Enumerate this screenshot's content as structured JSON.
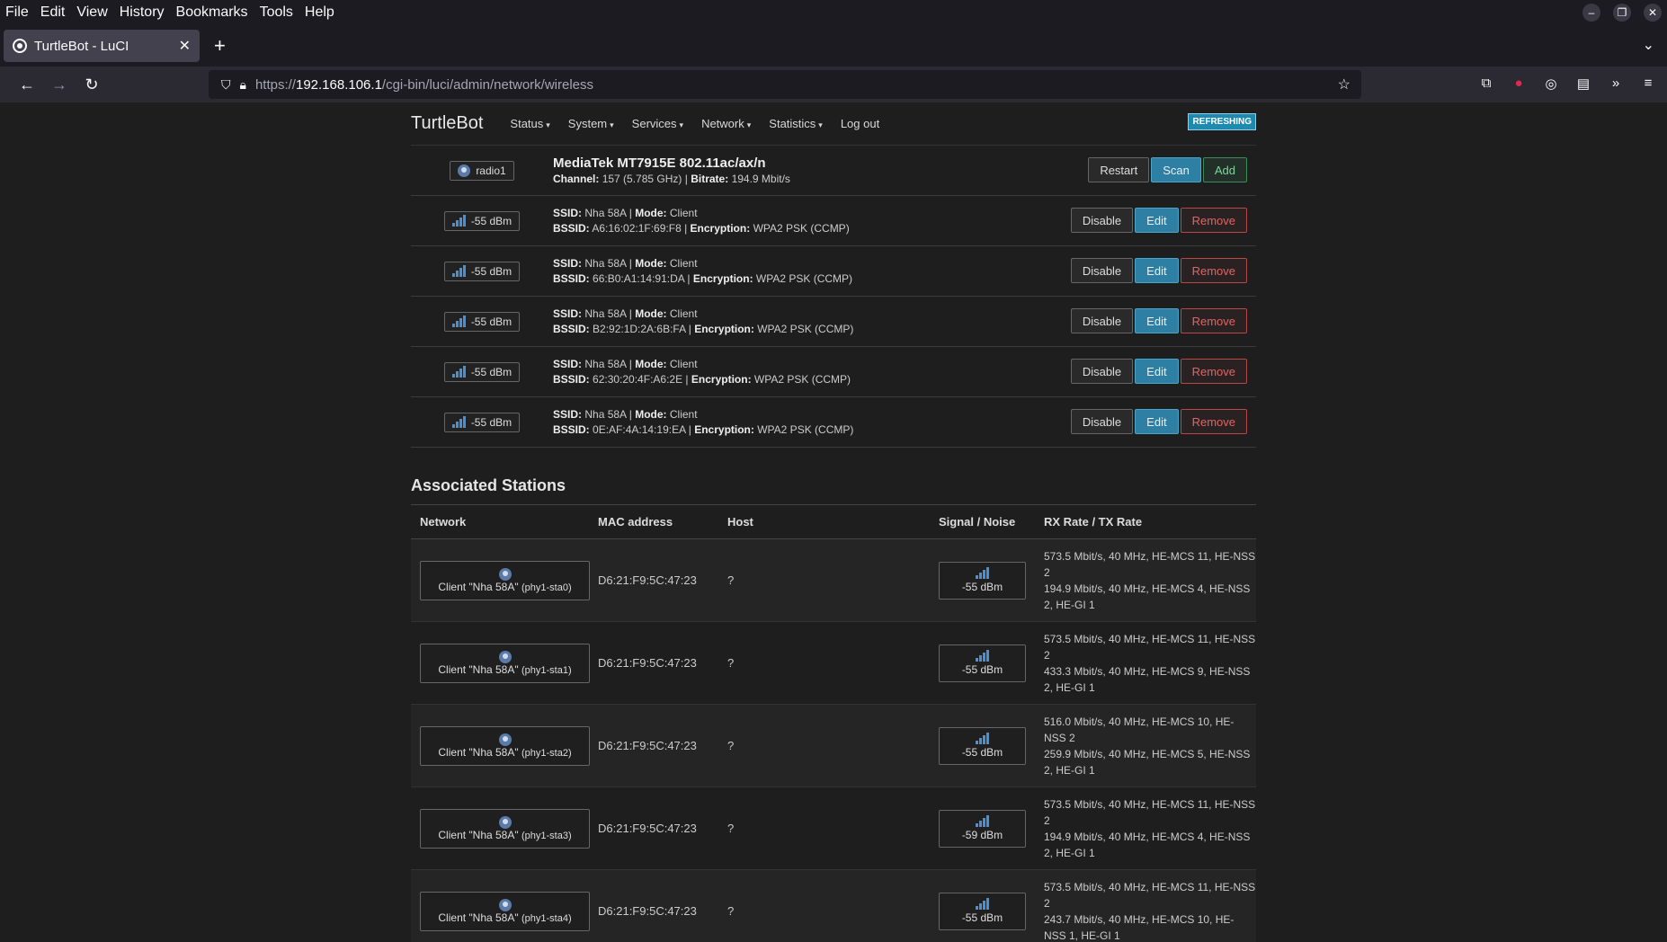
{
  "browser": {
    "menu": [
      "File",
      "Edit",
      "View",
      "History",
      "Bookmarks",
      "Tools",
      "Help"
    ],
    "tab_title": "TurtleBot - LuCI",
    "url_prefix": "https://",
    "url_host": "192.168.106.1",
    "url_path": "/cgi-bin/luci/admin/network/wireless"
  },
  "header": {
    "brand": "TurtleBot",
    "nav": [
      "Status",
      "System",
      "Services",
      "Network",
      "Statistics"
    ],
    "logout": "Log out",
    "refreshing": "REFRESHING"
  },
  "radio": {
    "name": "radio1",
    "model": "MediaTek MT7915E 802.11ac/ax/n",
    "channel_label": "Channel:",
    "channel": "157 (5.785 GHz)",
    "bitrate_label": "Bitrate:",
    "bitrate": "194.9 Mbit/s",
    "buttons": [
      "Restart",
      "Scan",
      "Add"
    ]
  },
  "wifi_rows": [
    {
      "signal": "-55 dBm",
      "ssid": "Nha 58A",
      "mode": "Client",
      "bssid": "A6:16:02:1F:69:F8",
      "encryption": "WPA2 PSK (CCMP)"
    },
    {
      "signal": "-55 dBm",
      "ssid": "Nha 58A",
      "mode": "Client",
      "bssid": "66:B0:A1:14:91:DA",
      "encryption": "WPA2 PSK (CCMP)"
    },
    {
      "signal": "-55 dBm",
      "ssid": "Nha 58A",
      "mode": "Client",
      "bssid": "B2:92:1D:2A:6B:FA",
      "encryption": "WPA2 PSK (CCMP)"
    },
    {
      "signal": "-55 dBm",
      "ssid": "Nha 58A",
      "mode": "Client",
      "bssid": "62:30:20:4F:A6:2E",
      "encryption": "WPA2 PSK (CCMP)"
    },
    {
      "signal": "-55 dBm",
      "ssid": "Nha 58A",
      "mode": "Client",
      "bssid": "0E:AF:4A:14:19:EA",
      "encryption": "WPA2 PSK (CCMP)"
    }
  ],
  "labels": {
    "ssid": "SSID:",
    "mode": "Mode:",
    "bssid": "BSSID:",
    "encryption": "Encryption:",
    "disable": "Disable",
    "edit": "Edit",
    "remove": "Remove"
  },
  "stations": {
    "title": "Associated Stations",
    "columns": [
      "Network",
      "MAC address",
      "Host",
      "Signal / Noise",
      "RX Rate / TX Rate"
    ],
    "rows": [
      {
        "network": "Client \"Nha 58A\"",
        "iface": "(phy1-sta0)",
        "mac": "D6:21:F9:5C:47:23",
        "host": "?",
        "signal": "-55 dBm",
        "rx": "573.5 Mbit/s, 40 MHz, HE-MCS 11, HE-NSS 2",
        "tx": "194.9 Mbit/s, 40 MHz, HE-MCS 4, HE-NSS 2, HE-GI 1"
      },
      {
        "network": "Client \"Nha 58A\"",
        "iface": "(phy1-sta1)",
        "mac": "D6:21:F9:5C:47:23",
        "host": "?",
        "signal": "-55 dBm",
        "rx": "573.5 Mbit/s, 40 MHz, HE-MCS 11, HE-NSS 2",
        "tx": "433.3 Mbit/s, 40 MHz, HE-MCS 9, HE-NSS 2, HE-GI 1"
      },
      {
        "network": "Client \"Nha 58A\"",
        "iface": "(phy1-sta2)",
        "mac": "D6:21:F9:5C:47:23",
        "host": "?",
        "signal": "-55 dBm",
        "rx": "516.0 Mbit/s, 40 MHz, HE-MCS 10, HE-NSS 2",
        "tx": "259.9 Mbit/s, 40 MHz, HE-MCS 5, HE-NSS 2, HE-GI 1"
      },
      {
        "network": "Client \"Nha 58A\"",
        "iface": "(phy1-sta3)",
        "mac": "D6:21:F9:5C:47:23",
        "host": "?",
        "signal": "-59 dBm",
        "rx": "573.5 Mbit/s, 40 MHz, HE-MCS 11, HE-NSS 2",
        "tx": "194.9 Mbit/s, 40 MHz, HE-MCS 4, HE-NSS 2, HE-GI 1"
      },
      {
        "network": "Client \"Nha 58A\"",
        "iface": "(phy1-sta4)",
        "mac": "D6:21:F9:5C:47:23",
        "host": "?",
        "signal": "-55 dBm",
        "rx": "573.5 Mbit/s, 40 MHz, HE-MCS 11, HE-NSS 2",
        "tx": "243.7 Mbit/s, 40 MHz, HE-MCS 10, HE-NSS 1, HE-GI 1"
      }
    ]
  }
}
